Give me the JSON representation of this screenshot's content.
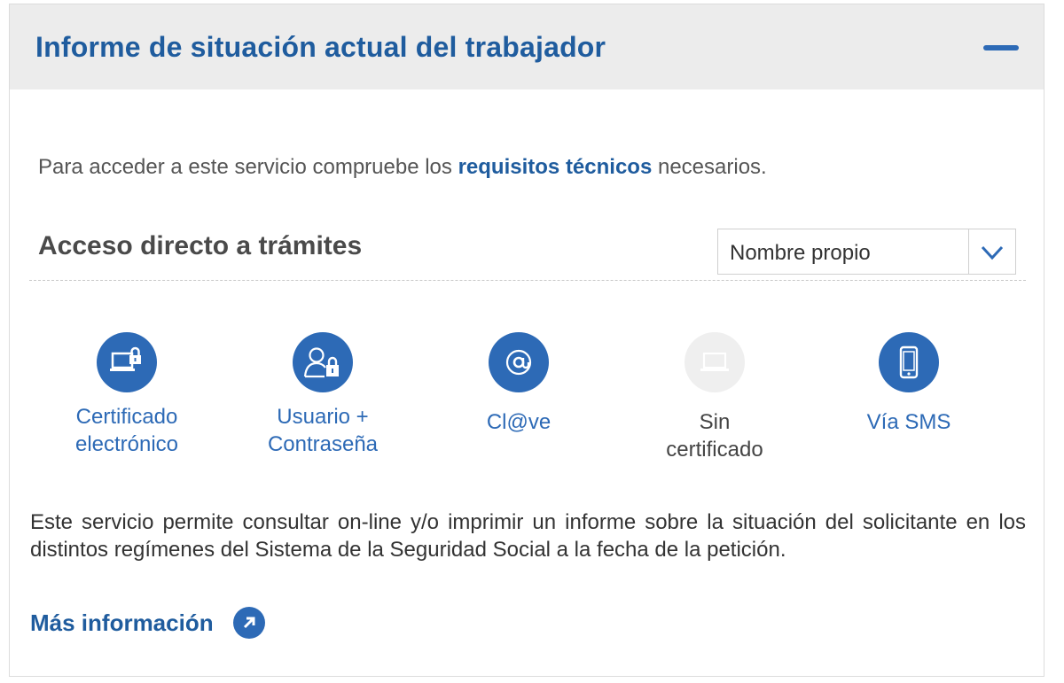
{
  "panel": {
    "title": "Informe de situación actual del trabajador",
    "collapse_icon": "minus-icon"
  },
  "intro": {
    "prefix": "Para acceder a este servicio compruebe los",
    "link": "requisitos técnicos",
    "suffix": "necesarios."
  },
  "access": {
    "title": "Acceso directo a trámites",
    "select_value": "Nombre propio",
    "methods": [
      {
        "line1": "Certificado",
        "line2": "electrónico",
        "icon": "laptop-lock-icon"
      },
      {
        "line1": "Usuario +",
        "line2": "Contraseña",
        "icon": "user-lock-icon"
      },
      {
        "line1": "Cl@ve",
        "line2": "",
        "icon": "at-icon"
      },
      {
        "line1": "Sin",
        "line2": "certificado",
        "icon": "laptop-icon"
      },
      {
        "line1": "Vía SMS",
        "line2": "",
        "icon": "mobile-icon"
      }
    ]
  },
  "description": "Este servicio permite consultar on-line y/o imprimir un informe sobre la situación del solicitante en los distintos regímenes del Sistema de la Seguridad Social a la fecha de la petición.",
  "more_info": {
    "label": "Más información",
    "icon": "arrow-up-right-icon"
  },
  "colors": {
    "accent": "#2d6ab6",
    "title": "#1f5c9e",
    "header_bg": "#ececec",
    "disabled": "#efefef"
  }
}
